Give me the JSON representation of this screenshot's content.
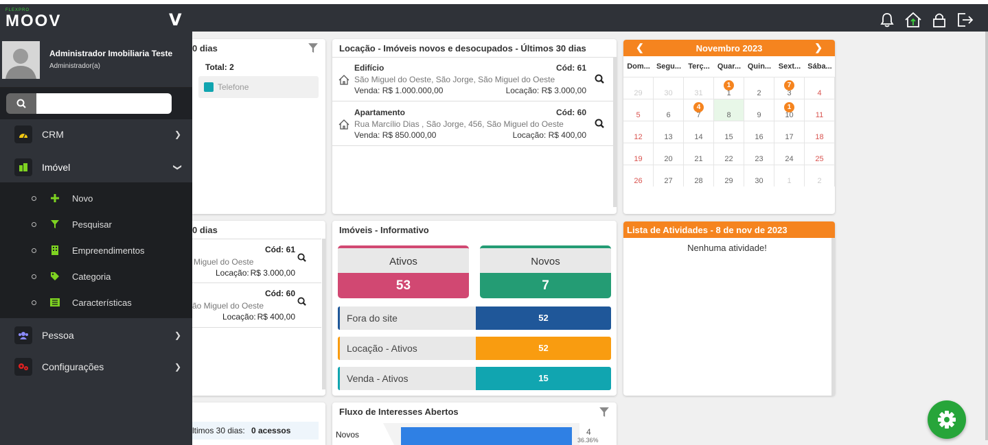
{
  "app": {
    "logo_small": "FLEXPRO",
    "logo_big": "MOOV"
  },
  "profile": {
    "name": "Administrador Imobiliaria Teste",
    "role": "Administrador(a)"
  },
  "search": {
    "placeholder": ""
  },
  "menu": {
    "crm": "CRM",
    "imovel": "Imóvel",
    "pessoa": "Pessoa",
    "configuracoes": "Configurações",
    "sub": [
      "Novo",
      "Pesquisar",
      "Empreendimentos",
      "Categoria",
      "Características"
    ]
  },
  "card1": {
    "title_partial": "0 dias",
    "total": "Total: 2",
    "telefone": "Telefone"
  },
  "card2": {
    "title_partial": "0 dias",
    "cod1": "Cód: 61",
    "addr1": "Miguel do Oeste",
    "loc1_label": "Locação:",
    "loc1_val": "R$ 3.000,00",
    "cod2": "Cód: 60",
    "addr2": "ão Miguel do Oeste",
    "loc2_label": "Locação:",
    "loc2_val": "R$ 400,00"
  },
  "card3": {
    "text_label": "ltimos 30 dias:",
    "text_val": "0 acessos"
  },
  "locacao": {
    "title": "Locação - Imóveis novos e desocupados - Últimos 30 dias",
    "items": [
      {
        "type": "Edifício",
        "cod": "Cód: 61",
        "address": "São Miguel do Oeste, São Jorge, São Miguel do Oeste",
        "venda_label": "Venda:",
        "venda": "R$ 1.000.000,00",
        "loc_label": "Locação:",
        "loc": "R$ 3.000,00"
      },
      {
        "type": "Apartamento",
        "cod": "Cód: 60",
        "address": "Rua Marcílio Dias , São Jorge, 456, São Miguel do Oeste",
        "venda_label": "Venda:",
        "venda": "R$ 850.000,00",
        "loc_label": "Locação:",
        "loc": "R$ 400,00"
      }
    ]
  },
  "info": {
    "title": "Imóveis - Informativo",
    "ativos_label": "Ativos",
    "ativos_val": "53",
    "novos_label": "Novos",
    "novos_val": "7",
    "rows": [
      {
        "label": "Fora do site",
        "value": "52"
      },
      {
        "label": "Locação - Ativos",
        "value": "52"
      },
      {
        "label": "Venda - Ativos",
        "value": "15"
      }
    ]
  },
  "fluxo": {
    "title": "Fluxo de Interesses Abertos",
    "label": "Novos",
    "value": "4",
    "pct": "36.36%"
  },
  "calendar": {
    "month": "Novembro 2023",
    "weekdays": [
      "Dom...",
      "Segu...",
      "Terç...",
      "Quar...",
      "Quin...",
      "Sext...",
      "Sába..."
    ],
    "weeks": [
      [
        "29",
        "30",
        "31",
        "1",
        "2",
        "3",
        "4"
      ],
      [
        "5",
        "6",
        "7",
        "8",
        "9",
        "10",
        "11"
      ],
      [
        "12",
        "13",
        "14",
        "15",
        "16",
        "17",
        "18"
      ],
      [
        "19",
        "20",
        "21",
        "22",
        "23",
        "24",
        "25"
      ],
      [
        "26",
        "27",
        "28",
        "29",
        "30",
        "1",
        "2"
      ]
    ],
    "badges": {
      "1": "1",
      "3": "7",
      "7": "4",
      "10": "1"
    }
  },
  "atividades": {
    "title": "Lista de Atividades - 8 de nov de 2023",
    "empty": "Nenhuma atividade!"
  },
  "colors": {
    "accent_orange": "#f5841f",
    "green": "#27a53a",
    "pink": "#d14872",
    "teal_green": "#249c74",
    "blue": "#1f5799",
    "cyan": "#11a5b0"
  }
}
